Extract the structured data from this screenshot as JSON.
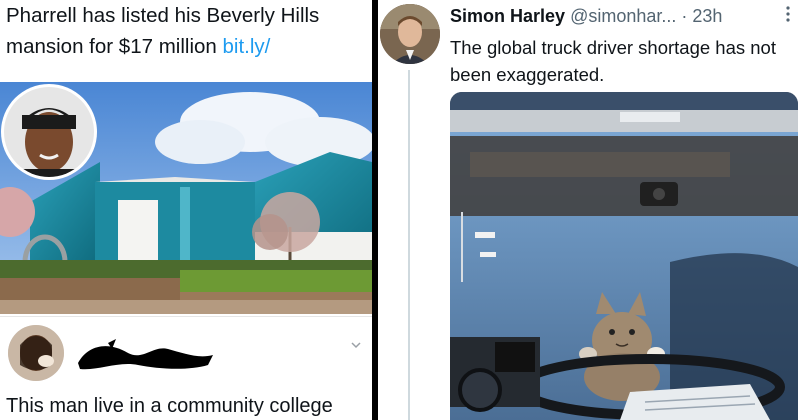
{
  "left_post": {
    "text_main": "Pharrell has listed his Beverly Hills mansion for $17 million ",
    "link_text": "bit.ly/"
  },
  "reply": {
    "text": "This man live in a community college"
  },
  "right_post": {
    "name": "Simon Harley",
    "handle": "@simonhar...",
    "separator": "·",
    "time": "23h",
    "text": "The global truck driver shortage has not been exaggerated."
  },
  "colors": {
    "link": "#1d9bf0",
    "text": "#0f1419",
    "muted": "#536471"
  }
}
